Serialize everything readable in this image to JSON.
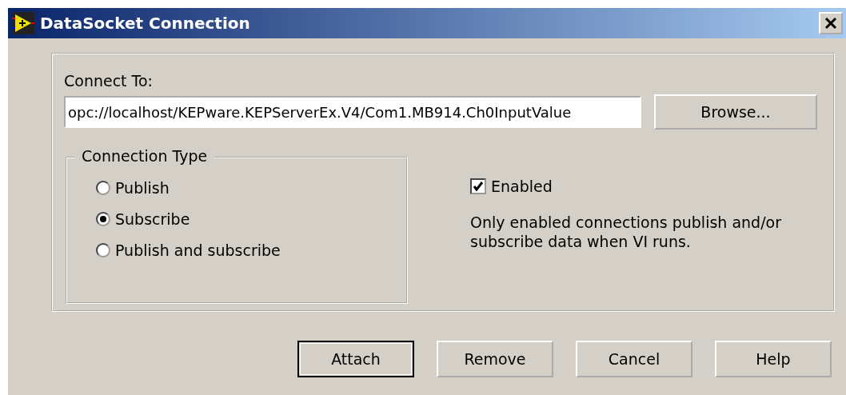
{
  "window": {
    "title": "DataSocket Connection"
  },
  "connect_to": {
    "label": "Connect To:",
    "value": "opc://localhost/KEPware.KEPServerEx.V4/Com1.MB914.Ch0InputValue",
    "browse_button": "Browse..."
  },
  "connection_type": {
    "title": "Connection Type",
    "options": [
      {
        "label": "Publish",
        "selected": false
      },
      {
        "label": "Subscribe",
        "selected": true
      },
      {
        "label": "Publish and subscribe",
        "selected": false
      }
    ]
  },
  "enabled": {
    "label": "Enabled",
    "checked": true,
    "description": "Only enabled connections publish and/or subscribe data when VI runs."
  },
  "buttons": [
    {
      "label": "Attach",
      "default": true
    },
    {
      "label": "Remove",
      "default": false
    },
    {
      "label": "Cancel",
      "default": false
    },
    {
      "label": "Help",
      "default": false
    }
  ]
}
